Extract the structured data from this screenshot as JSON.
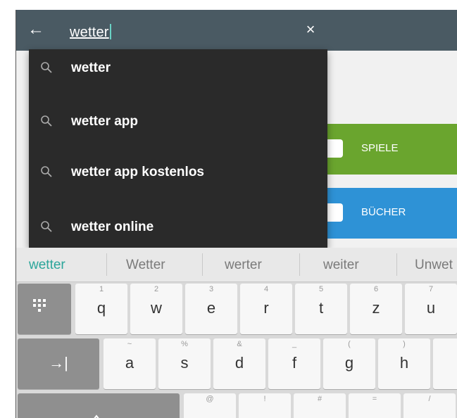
{
  "search": {
    "query": "wetter",
    "back_icon": "←",
    "clear_icon": "×"
  },
  "suggestions": [
    {
      "text": "wetter"
    },
    {
      "text": "wetter app"
    },
    {
      "text": "wetter app kostenlos"
    },
    {
      "text": "wetter online"
    }
  ],
  "tiles": {
    "spiele": "SPIELE",
    "buecher": "BÜCHER"
  },
  "word_suggestions": [
    "wetter",
    "Wetter",
    "werter",
    "weiter",
    "Unwet"
  ],
  "keyboard": {
    "row1": [
      {
        "hint": "1",
        "key": "q"
      },
      {
        "hint": "2",
        "key": "w"
      },
      {
        "hint": "3",
        "key": "e"
      },
      {
        "hint": "4",
        "key": "r"
      },
      {
        "hint": "5",
        "key": "t"
      },
      {
        "hint": "6",
        "key": "z"
      },
      {
        "hint": "7",
        "key": "u"
      }
    ],
    "row2": [
      {
        "hint": "~",
        "key": "a"
      },
      {
        "hint": "%",
        "key": "s"
      },
      {
        "hint": "&",
        "key": "d"
      },
      {
        "hint": "_",
        "key": "f"
      },
      {
        "hint": "(",
        "key": "g"
      },
      {
        "hint": ")",
        "key": "h"
      }
    ],
    "tab_symbol": "→|",
    "row3_hints": [
      "@",
      "!",
      "#",
      "=",
      "/"
    ]
  }
}
